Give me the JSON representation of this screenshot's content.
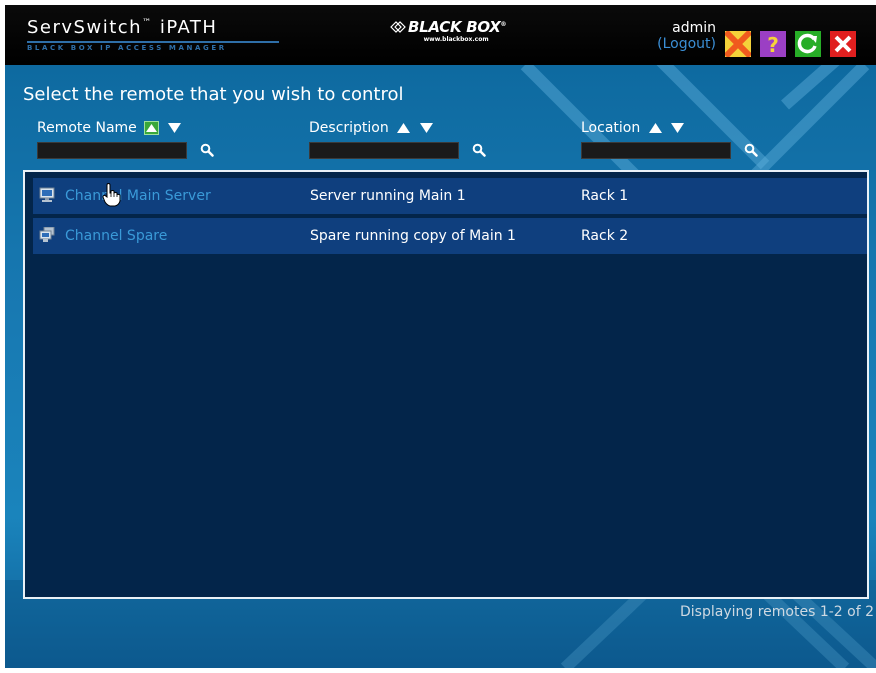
{
  "header": {
    "product_name": "ServSwitch",
    "product_tm": "™",
    "product_suffix": "iPATH",
    "product_tagline": "BLACK BOX IP ACCESS MANAGER",
    "brand_name": "BLACK BOX",
    "brand_tm": "®",
    "brand_url": "www.blackbox.com",
    "user": "admin",
    "logout": "(Logout)",
    "buttons": [
      {
        "icon": "cancel-x-icon",
        "color": "#f29a1f"
      },
      {
        "icon": "help-icon",
        "color": "#a347c8"
      },
      {
        "icon": "refresh-icon",
        "color": "#29b229"
      },
      {
        "icon": "close-icon",
        "color": "#e02020"
      }
    ]
  },
  "page": {
    "heading": "Select the remote that you wish to control"
  },
  "columns": [
    {
      "label": "Remote Name",
      "sort_active": "asc"
    },
    {
      "label": "Description",
      "sort_active": "none"
    },
    {
      "label": "Location",
      "sort_active": "none"
    }
  ],
  "filters": [
    {
      "value": "",
      "placeholder": ""
    },
    {
      "value": "",
      "placeholder": ""
    },
    {
      "value": "",
      "placeholder": ""
    }
  ],
  "remotes": [
    {
      "name": "Channel Main Server",
      "description": "Server running Main 1",
      "location": "Rack 1",
      "icon": "monitor-icon"
    },
    {
      "name": "Channel Spare",
      "description": "Spare running copy of Main 1",
      "location": "Rack 2",
      "icon": "dual-monitor-icon"
    }
  ],
  "status": "Displaying remotes 1-2 of 2",
  "colors": {
    "accent": "#3a9ad8",
    "row_bg": "#0f3f7e",
    "list_bg": "#03254a",
    "main_bg": "#1879b2"
  }
}
